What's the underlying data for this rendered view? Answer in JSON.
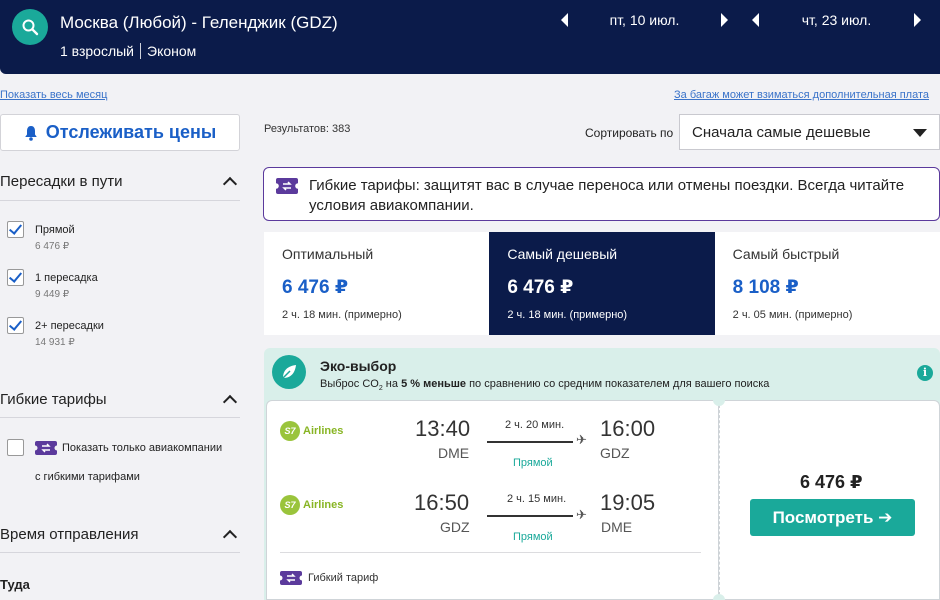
{
  "header": {
    "route": "Москва (Любой) - Геленджик (GDZ)",
    "passengers": "1 взрослый",
    "cabin": "Эконом",
    "date_out": "пт, 10 июл.",
    "date_back": "чт, 23 июл."
  },
  "links": {
    "month": "Показать весь месяц",
    "baggage": "За багаж может взиматься дополнительная плата"
  },
  "sidebar": {
    "track_label": "Отслеживать цены",
    "stops": {
      "title": "Пересадки в пути",
      "options": [
        {
          "label": "Прямой",
          "price": "6 476 ₽",
          "checked": true
        },
        {
          "label": "1 пересадка",
          "price": "9 449 ₽",
          "checked": true
        },
        {
          "label": "2+ пересадки",
          "price": "14 931 ₽",
          "checked": true
        }
      ]
    },
    "flex": {
      "title": "Гибкие тарифы",
      "option_line1": "Показать только авиакомпании",
      "option_line2": "с гибкими тарифами",
      "checked": false
    },
    "departure_time": {
      "title": "Время отправления",
      "subtitle": "Туда"
    }
  },
  "results": {
    "count_text": "Результатов: 383",
    "sort_label": "Сортировать по",
    "sort_value": "Сначала самые дешевые"
  },
  "flex_banner": "Гибкие тарифы: защитят вас в случае переноса или отмены поездки. Всегда читайте условия авиакомпании.",
  "tabs": [
    {
      "name": "Оптимальный",
      "price": "6 476 ₽",
      "duration": "2 ч. 18 мин. (примерно)",
      "active": false
    },
    {
      "name": "Самый дешевый",
      "price": "6 476 ₽",
      "duration": "2 ч. 18 мин. (примерно)",
      "active": true
    },
    {
      "name": "Самый быстрый",
      "price": "8 108 ₽",
      "duration": "2 ч. 05 мин. (примерно)",
      "active": false
    }
  ],
  "eco": {
    "title": "Эко-выбор",
    "desc_before": "Выброс CO",
    "desc_sub": "2",
    "desc_mid": " на ",
    "desc_bold": "5 % меньше",
    "desc_after": " по сравнению со средним показателем для вашего поиска"
  },
  "card": {
    "segments": [
      {
        "airline": "Airlines",
        "dep_time": "13:40",
        "dep_code": "DME",
        "duration": "2 ч. 20 мин.",
        "stops": "Прямой",
        "arr_time": "16:00",
        "arr_code": "GDZ"
      },
      {
        "airline": "Airlines",
        "dep_time": "16:50",
        "dep_code": "GDZ",
        "duration": "2 ч. 15 мин.",
        "stops": "Прямой",
        "arr_time": "19:05",
        "arr_code": "DME"
      }
    ],
    "flex_tariff": "Гибкий тариф",
    "price": "6 476 ₽",
    "view_label": "Посмотреть ➔"
  },
  "colors": {
    "navy": "#0b1b4a",
    "teal": "#1aa99a",
    "blue": "#1a5fc7",
    "purple": "#5b3a9c",
    "eco_bg": "#d9efea"
  }
}
